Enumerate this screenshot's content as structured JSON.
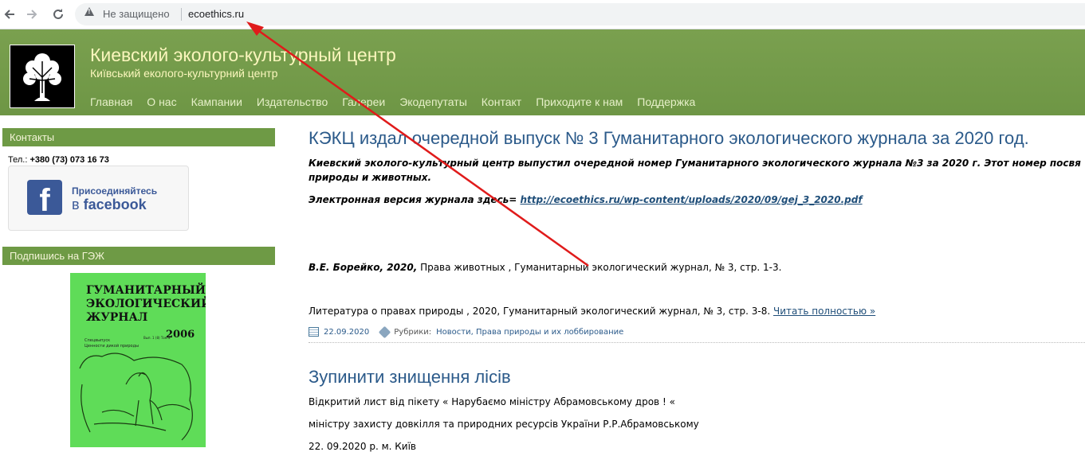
{
  "browser": {
    "back_icon": "arrow-left-icon",
    "forward_icon": "arrow-right-icon",
    "reload_icon": "reload-icon",
    "security_label": "Не защищено",
    "url": "ecoethics.ru"
  },
  "site": {
    "title": "Киевский эколого-культурный центр",
    "subtitle": "Київський еколого-культурний центр",
    "menu": [
      "Главная",
      "О нас",
      "Кампании",
      "Издательство",
      "Галереи",
      "Экодепутаты",
      "Контакт",
      "Приходите к нам",
      "Поддержка"
    ]
  },
  "sidebar": {
    "contacts_title": "Контакты",
    "phone_label": "Тел.:",
    "phone_number": "+380 (73) 073 16 73",
    "facebook_join": "Присоединяйтесь",
    "facebook_prefix": "в",
    "facebook_brand": "facebook",
    "subscribe_title": "Подпишись на ГЭЖ",
    "journal_cover": {
      "title_line1": "ГУМАНИТАРНЫЙ",
      "title_line2": "ЭКОЛОГИЧЕСКИЙ",
      "title_line3": "ЖУРНАЛ",
      "year": "2006",
      "supplement": "Спецвыпуск",
      "subtitle": "Ценности дикой природы",
      "volume": "Вып. 1 (8) Том 8"
    }
  },
  "posts": [
    {
      "title": "КЭКЦ издал очередной выпуск № 3 Гуманитарного экологического журнала за 2020 год.",
      "intro_line1": "Киевский эколого-культурный центр выпустил очередной  номер Гуманитарного экологического журнала №3 за 2020 г. Этот номер посвя",
      "intro_line2": "природы и животных.",
      "electronic_label": "Электронная версия журнала здесь= ",
      "electronic_link": "http://ecoethics.ru/wp-content/uploads/2020/09/gej_3_2020.pdf",
      "citation_author": "В.Е. Борейко, 2020,",
      "citation_rest": " Права животных , Гуманитарный экологический журнал, № 3, стр. 1-3.",
      "literature": "Литература о правах природы , 2020, Гуманитарный экологический журнал, № 3, стр. 3-8. ",
      "read_more": "Читать полностью »",
      "date": "22.09.2020",
      "rubrics_label": "Рубрики:",
      "rubrics": "Новости, Права природы и их лоббирование"
    },
    {
      "title": "Зупинити знищення лісів",
      "line1": "Відкритий лист  від пікету « Нарубаємо міністру Абрамовському дров ! «",
      "line2": "міністру  захисту довкілля та природних ресурсів України Р.Р.Абрамовському",
      "line3": "22. 09.2020 р.  м. Київ"
    }
  ],
  "colors": {
    "header_green": "#7aa04f",
    "title_yellow": "#fbf6bd",
    "link_blue": "#2b5a8a",
    "annotation_arrow": "#e01b1b"
  }
}
